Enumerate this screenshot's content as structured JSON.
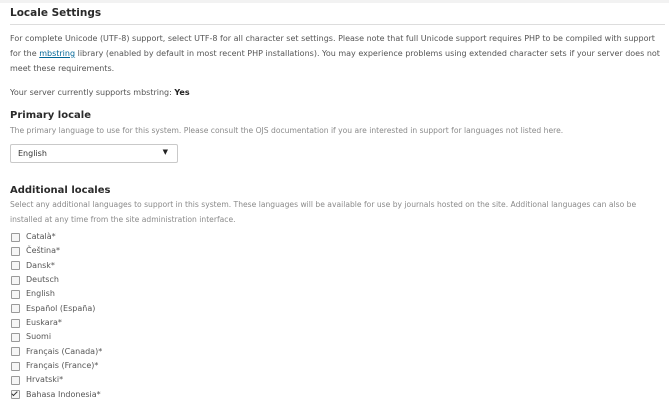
{
  "section": {
    "title": "Locale Settings"
  },
  "intro": {
    "before_link": "For complete Unicode (UTF-8) support, select UTF-8 for all character set settings. Please note that full Unicode support requires PHP to be compiled with support for the ",
    "link": "mbstring",
    "after_link": " library (enabled by default in most recent PHP installations). You may experience problems using extended character sets if your server does not meet these requirements."
  },
  "mbstring_status": {
    "label": "Your server currently supports mbstring: ",
    "value": "Yes"
  },
  "primary_locale": {
    "title": "Primary locale",
    "description": "The primary language to use for this system. Please consult the OJS documentation if you are interested in support for languages not listed here.",
    "selected": "English"
  },
  "additional_locales": {
    "title": "Additional locales",
    "description": "Select any additional languages to support in this system. These languages will be available for use by journals hosted on the site. Additional languages can also be installed at any time from the site administration interface.",
    "items": [
      {
        "label": "Català*",
        "checked": false
      },
      {
        "label": "Čeština*",
        "checked": false
      },
      {
        "label": "Dansk*",
        "checked": false
      },
      {
        "label": "Deutsch",
        "checked": false
      },
      {
        "label": "English",
        "checked": false
      },
      {
        "label": "Español (España)",
        "checked": false
      },
      {
        "label": "Euskara*",
        "checked": false
      },
      {
        "label": "Suomi",
        "checked": false
      },
      {
        "label": "Français (Canada)*",
        "checked": false
      },
      {
        "label": "Français (France)*",
        "checked": false
      },
      {
        "label": "Hrvatski*",
        "checked": false
      },
      {
        "label": "Bahasa Indonesia*",
        "checked": true
      }
    ]
  }
}
